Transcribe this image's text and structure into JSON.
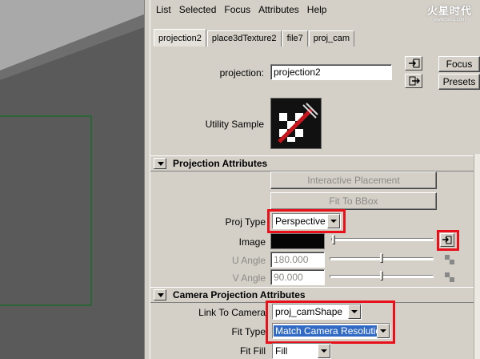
{
  "menu": [
    "List",
    "Selected",
    "Focus",
    "Attributes",
    "Help"
  ],
  "watermark": {
    "main": "火星时代",
    "sub": "www.hxsd.com"
  },
  "tabs": [
    {
      "label": "projection2",
      "active": true
    },
    {
      "label": "place3dTexture2",
      "active": false
    },
    {
      "label": "file7",
      "active": false
    },
    {
      "label": "proj_cam",
      "active": false
    }
  ],
  "node": {
    "label": "projection:",
    "value": "projection2",
    "focus_label": "Focus",
    "presets_label": "Presets",
    "utility_sample_label": "Utility Sample"
  },
  "projection_section": {
    "title": "Projection Attributes",
    "interactive_placement_label": "Interactive Placement",
    "fit_to_bbox_label": "Fit To BBox",
    "proj_type_label": "Proj Type",
    "proj_type_value": "Perspective",
    "image_label": "Image",
    "image_color": "#050505",
    "u_angle_label": "U Angle",
    "u_angle_value": "180.000",
    "v_angle_label": "V Angle",
    "v_angle_value": "90.000"
  },
  "camera_section": {
    "title": "Camera Projection Attributes",
    "link_label": "Link To Camera",
    "link_value": "proj_camShape",
    "fit_type_label": "Fit Type",
    "fit_type_value": "Match Camera Resolution",
    "fit_fill_label": "Fit Fill",
    "fit_fill_value": "Fill"
  },
  "colors": {
    "highlight": "#e8101a",
    "selection": "#316ac5",
    "viewport_grid": "#1e6b2a"
  }
}
